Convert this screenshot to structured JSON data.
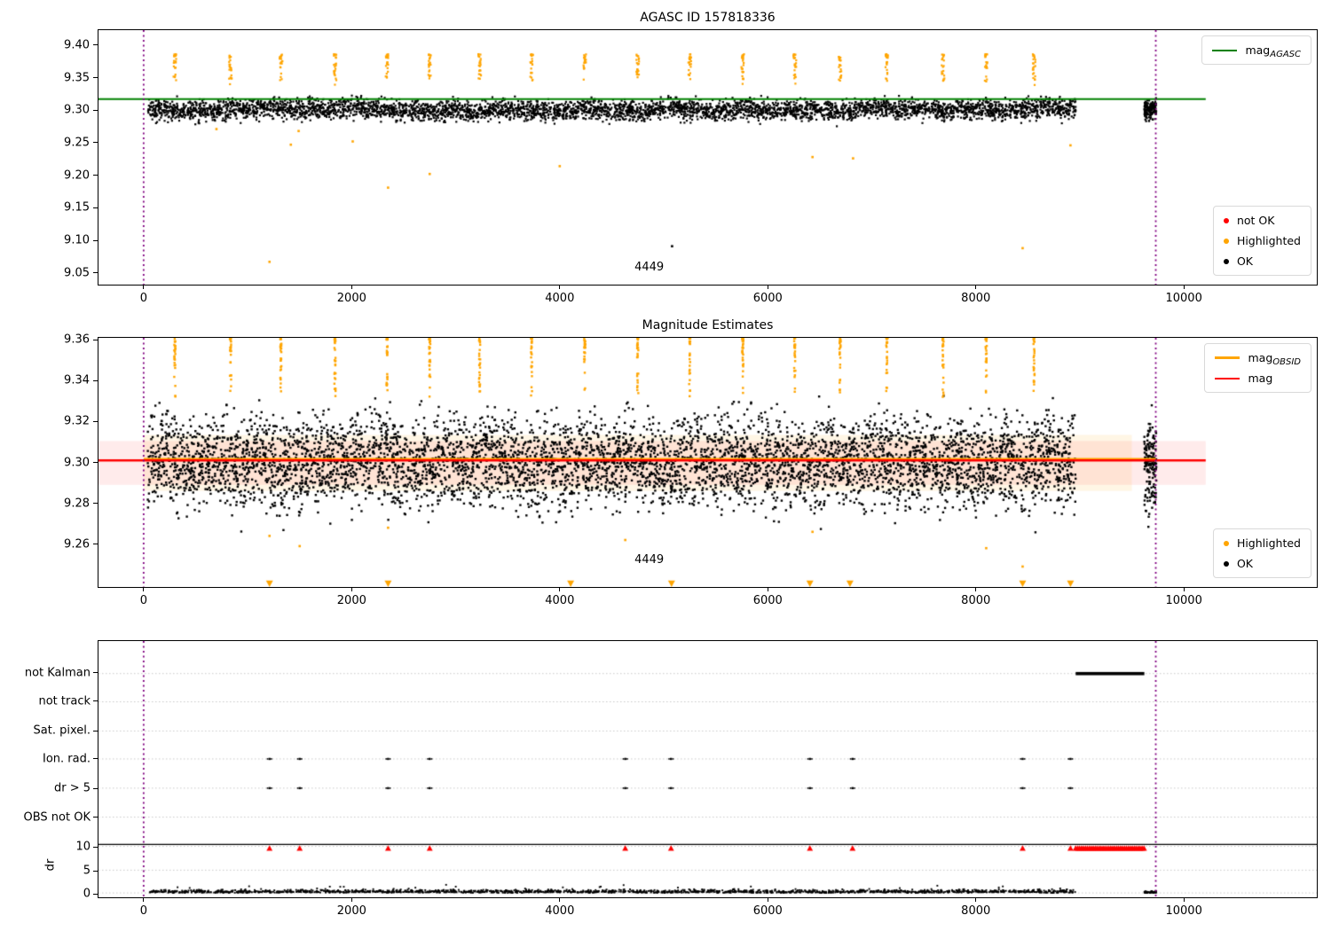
{
  "colors": {
    "ok": "#000000",
    "highlighted": "#ffa500",
    "not_ok": "#ff0000",
    "mag_agasc_line": "#008000",
    "mag_line": "#ff0000",
    "mag_obsid_line": "#ffa500",
    "vline": "#800080",
    "mag_err_band": "rgba(255,0,0,0.08)",
    "obsid_band": "rgba(255,165,0,0.10)",
    "grid": "#c8c8c8"
  },
  "plot1": {
    "title": "AGASC ID 157818336",
    "legend_line": {
      "label_main": "mag",
      "label_sub": "AGASC"
    },
    "legend_points": [
      {
        "label": "not OK",
        "color": "#ff0000"
      },
      {
        "label": "Highlighted",
        "color": "#ffa500"
      },
      {
        "label": "OK",
        "color": "#000000"
      }
    ],
    "annotation": "4449"
  },
  "plot2": {
    "title": "Magnitude Estimates",
    "legend_lines": [
      {
        "label_main": "mag",
        "label_sub": "OBSID",
        "color": "#ffa500"
      },
      {
        "label_main": "mag",
        "label_sub": "",
        "color": "#ff0000"
      }
    ],
    "legend_points": [
      {
        "label": "Highlighted",
        "color": "#ffa500"
      },
      {
        "label": "OK",
        "color": "#000000"
      }
    ],
    "annotation": "4449"
  },
  "plot3": {
    "ylabel": "dr"
  },
  "chart_data": [
    {
      "type": "scatter",
      "title": "AGASC ID 157818336",
      "xlim": [
        -434,
        11278
      ],
      "ylim": [
        9.032,
        9.423
      ],
      "xticks": [
        0,
        2000,
        4000,
        6000,
        8000,
        10000
      ],
      "xtick_labels": [
        "0",
        "2000",
        "4000",
        "6000",
        "8000",
        "10000"
      ],
      "yticks": [
        9.05,
        9.1,
        9.15,
        9.2,
        9.25,
        9.3,
        9.35,
        9.4
      ],
      "ytick_labels": [
        "9.05",
        "9.10",
        "9.15",
        "9.20",
        "9.25",
        "9.30",
        "9.35",
        "9.40"
      ],
      "mag_agasc_line": {
        "y": 9.317,
        "color": "#008000",
        "x_span": [
          -434,
          10210
        ]
      },
      "vlines": {
        "x": [
          0,
          9730
        ],
        "color": "#800080",
        "style": "dotted"
      },
      "annotation": {
        "text": "4449",
        "x": 4860,
        "y": 9.058
      },
      "ok_points": {
        "color": "#000000",
        "x_range": [
          40,
          8960
        ],
        "extra_x_range": [
          9620,
          9735
        ],
        "y_center": 9.301,
        "y_sigma": 0.0075,
        "y_clip": [
          9.266,
          9.331
        ],
        "n_extra": 140
      },
      "highlighted_clusters": {
        "color": "#ffa500",
        "x": [
          300,
          835,
          1320,
          1840,
          2340,
          2750,
          3230,
          3730,
          4240,
          4750,
          5250,
          5760,
          6260,
          6695,
          7145,
          7685,
          8100,
          8560
        ],
        "y_range": [
          9.345,
          9.386
        ],
        "n_per": 22
      },
      "outliers": [
        {
          "x": 700,
          "y": 9.271,
          "c": "#ffa500"
        },
        {
          "x": 1210,
          "y": 9.067,
          "c": "#ffa500"
        },
        {
          "x": 1415,
          "y": 9.247,
          "c": "#ffa500"
        },
        {
          "x": 1490,
          "y": 9.268,
          "c": "#ffa500"
        },
        {
          "x": 2010,
          "y": 9.252,
          "c": "#ffa500"
        },
        {
          "x": 2350,
          "y": 9.181,
          "c": "#ffa500"
        },
        {
          "x": 2750,
          "y": 9.202,
          "c": "#ffa500"
        },
        {
          "x": 4000,
          "y": 9.214,
          "c": "#ffa500"
        },
        {
          "x": 5080,
          "y": 9.091,
          "c": "#000000"
        },
        {
          "x": 6430,
          "y": 9.228,
          "c": "#ffa500"
        },
        {
          "x": 6820,
          "y": 9.226,
          "c": "#ffa500"
        },
        {
          "x": 8450,
          "y": 9.088,
          "c": "#ffa500"
        },
        {
          "x": 8910,
          "y": 9.246,
          "c": "#ffa500"
        }
      ]
    },
    {
      "type": "scatter",
      "title": "Magnitude Estimates",
      "xlim": [
        -434,
        11278
      ],
      "ylim": [
        9.239,
        9.361
      ],
      "xticks": [
        0,
        2000,
        4000,
        6000,
        8000,
        10000
      ],
      "xtick_labels": [
        "0",
        "2000",
        "4000",
        "6000",
        "8000",
        "10000"
      ],
      "yticks": [
        9.26,
        9.28,
        9.3,
        9.32,
        9.34,
        9.36
      ],
      "ytick_labels": [
        "9.26",
        "9.28",
        "9.30",
        "9.32",
        "9.34",
        "9.36"
      ],
      "mag_line": {
        "y": 9.301,
        "color": "#ff0000",
        "x_span": [
          -434,
          10210
        ]
      },
      "mag_err_band": {
        "y_range": [
          9.289,
          9.3105
        ],
        "x_span": [
          -434,
          10210
        ]
      },
      "mag_obsid_line": {
        "y": 9.3015,
        "color": "#ffa500",
        "x_span": [
          0,
          9730
        ]
      },
      "obsid_band": {
        "y_range": [
          9.286,
          9.3135
        ],
        "x_span": [
          0,
          9500
        ]
      },
      "vlines": {
        "x": [
          0,
          9730
        ],
        "color": "#800080",
        "style": "dotted"
      },
      "annotation": {
        "text": "4449",
        "x": 4860,
        "y": 9.252
      },
      "ok_points": {
        "color": "#000000",
        "x_range": [
          40,
          8960
        ],
        "extra_x_range": [
          9620,
          9735
        ],
        "y_center": 9.3,
        "y_sigma": 0.011,
        "y_clip": [
          9.246,
          9.333
        ],
        "n_extra": 150
      },
      "highlighted_streaks": {
        "color": "#ffa500",
        "x": [
          300,
          835,
          1320,
          1840,
          2340,
          2750,
          3230,
          3730,
          4240,
          4750,
          5250,
          5760,
          6260,
          6695,
          7145,
          7685,
          8100,
          8560
        ],
        "y_range": [
          9.332,
          9.361
        ],
        "n_per": 26
      },
      "clipped_triangles": {
        "color": "#ffa500",
        "x": [
          1210,
          2350,
          4105,
          5075,
          6405,
          6790,
          8450,
          8910
        ]
      },
      "outliers": [
        {
          "x": 1210,
          "y": 9.264,
          "c": "#ffa500"
        },
        {
          "x": 1500,
          "y": 9.259,
          "c": "#ffa500"
        },
        {
          "x": 2350,
          "y": 9.268,
          "c": "#ffa500"
        },
        {
          "x": 4630,
          "y": 9.262,
          "c": "#ffa500"
        },
        {
          "x": 6430,
          "y": 9.266,
          "c": "#ffa500"
        },
        {
          "x": 8100,
          "y": 9.258,
          "c": "#ffa500"
        },
        {
          "x": 8450,
          "y": 9.249,
          "c": "#ffa500"
        }
      ]
    },
    {
      "type": "flags",
      "xlim": [
        -434,
        11278
      ],
      "xticks": [
        0,
        2000,
        4000,
        6000,
        8000,
        10000
      ],
      "xtick_labels": [
        "0",
        "2000",
        "4000",
        "6000",
        "8000",
        "10000"
      ],
      "categories": [
        "not Kalman",
        "not track",
        "Sat. pixel.",
        "Ion. rad.",
        "dr > 5",
        "OBS not OK"
      ],
      "dr_ticks": [
        10,
        5,
        0
      ],
      "dr_tick_labels": [
        "10",
        "5",
        "0"
      ],
      "ylabel": "dr",
      "grid": true,
      "flagged_x": [
        1210,
        1500,
        2350,
        2750,
        4630,
        5070,
        6405,
        6815,
        8450,
        8910
      ],
      "flag_rows_with_points": [
        "Ion. rad.",
        "dr > 5"
      ],
      "not_kalman_segment": [
        8960,
        9620
      ],
      "dr10_red": {
        "color": "#ff0000",
        "marker": "triangle_up",
        "points_x": [
          1210,
          1500,
          2350,
          2750,
          4630,
          5070,
          6405,
          6815,
          8450,
          8910
        ],
        "segment": [
          8960,
          9620
        ],
        "value": 10
      },
      "dr_points": {
        "color": "#000000",
        "x_range": [
          40,
          8960
        ],
        "extra_x_range": [
          9620,
          9735
        ],
        "typical_range": [
          0,
          1.5
        ]
      },
      "separator_line": {
        "color": "#000000",
        "full_width": true
      },
      "vlines": {
        "x": [
          0,
          9730
        ],
        "color": "#800080",
        "style": "dotted"
      }
    }
  ]
}
